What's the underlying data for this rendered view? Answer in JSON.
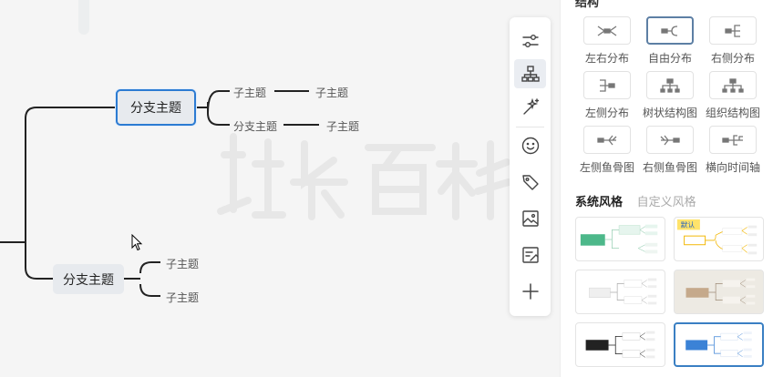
{
  "mindmap": {
    "branch_1": {
      "label": "分支主题",
      "children": [
        {
          "label": "子主题",
          "child": "子主题"
        },
        {
          "label": "分支主题",
          "child": "子主题"
        }
      ]
    },
    "branch_2": {
      "label": "分支主题",
      "children": [
        "子主题",
        "子主题"
      ]
    },
    "watermark": "站长百科"
  },
  "toolbar": {
    "tools": [
      {
        "icon": "sliders-icon",
        "name": "style-tool"
      },
      {
        "icon": "structure-icon",
        "name": "structure-tool"
      },
      {
        "icon": "magic-wand-icon",
        "name": "ai-tool"
      },
      {
        "icon": "emoji-icon",
        "name": "emoji-tool"
      },
      {
        "icon": "tag-icon",
        "name": "tag-tool"
      },
      {
        "icon": "image-icon",
        "name": "image-tool"
      },
      {
        "icon": "note-icon",
        "name": "note-tool"
      },
      {
        "icon": "plus-icon",
        "name": "add-tool"
      }
    ],
    "active_tool": "structure-tool"
  },
  "panel": {
    "section_title": "结构",
    "layouts": [
      {
        "label": "左右分布",
        "icon": "left-right-layout-icon"
      },
      {
        "label": "自由分布",
        "icon": "free-layout-icon",
        "selected": true
      },
      {
        "label": "右侧分布",
        "icon": "right-layout-icon"
      },
      {
        "label": "左侧分布",
        "icon": "left-layout-icon"
      },
      {
        "label": "树状结构图",
        "icon": "tree-chart-icon"
      },
      {
        "label": "组织结构图",
        "icon": "org-chart-icon"
      },
      {
        "label": "左侧鱼骨图",
        "icon": "left-fishbone-icon"
      },
      {
        "label": "右侧鱼骨图",
        "icon": "right-fishbone-icon"
      },
      {
        "label": "横向时间轴",
        "icon": "horizontal-timeline-icon"
      }
    ],
    "style_tabs": [
      {
        "label": "系统风格",
        "active": true
      },
      {
        "label": "自定义风格",
        "active": false
      }
    ],
    "themes": [
      {
        "name": "theme-green",
        "accent": "#4db88a",
        "bg": "#ffffff"
      },
      {
        "name": "theme-default",
        "accent": "#f2b600",
        "bg": "#ffffff",
        "badge": "默认"
      },
      {
        "name": "theme-gray",
        "accent": "#d9d9d9",
        "bg": "#ffffff"
      },
      {
        "name": "theme-tan",
        "accent": "#c5a98b",
        "bg": "#edeae3"
      },
      {
        "name": "theme-dark",
        "accent": "#222222",
        "bg": "#ffffff"
      },
      {
        "name": "theme-blue",
        "accent": "#3b82d6",
        "bg": "#ffffff",
        "selected": true
      }
    ]
  },
  "colors": {
    "selection": "#2c7bd2",
    "branch_fill": "#e7eaee",
    "line": "#222222"
  }
}
